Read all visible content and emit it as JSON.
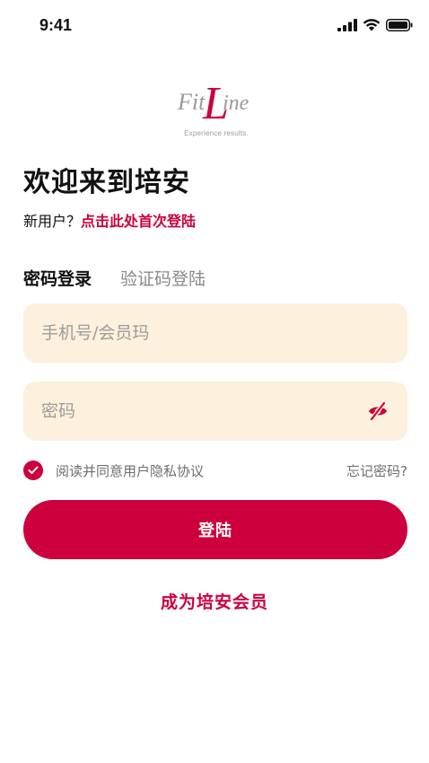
{
  "status_bar": {
    "time": "9:41",
    "icons": [
      "signal-icon",
      "wifi-icon",
      "battery-icon"
    ]
  },
  "logo": {
    "brand_fit": "Fit",
    "brand_l": "L",
    "brand_ine": "ine",
    "tagline": "Experience results."
  },
  "welcome": {
    "title": "欢迎来到培安",
    "new_user_prefix": "新用户？",
    "signup_link": "点击此处首次登陆"
  },
  "tabs": [
    {
      "label": "密码登录",
      "active": true
    },
    {
      "label": "验证码登陆",
      "active": false
    }
  ],
  "form": {
    "account_placeholder": "手机号/会员玛",
    "account_value": "",
    "password_placeholder": "密码",
    "password_value": ""
  },
  "agreement": {
    "checked": true,
    "text": "阅读并同意用户隐私协议",
    "forgot": "忘记密码?"
  },
  "login_button": "登陆",
  "member_link": "成为培安会员",
  "colors": {
    "accent": "#cc003d",
    "field_bg": "#fdf0dc",
    "muted_text": "#8a8a8a"
  }
}
